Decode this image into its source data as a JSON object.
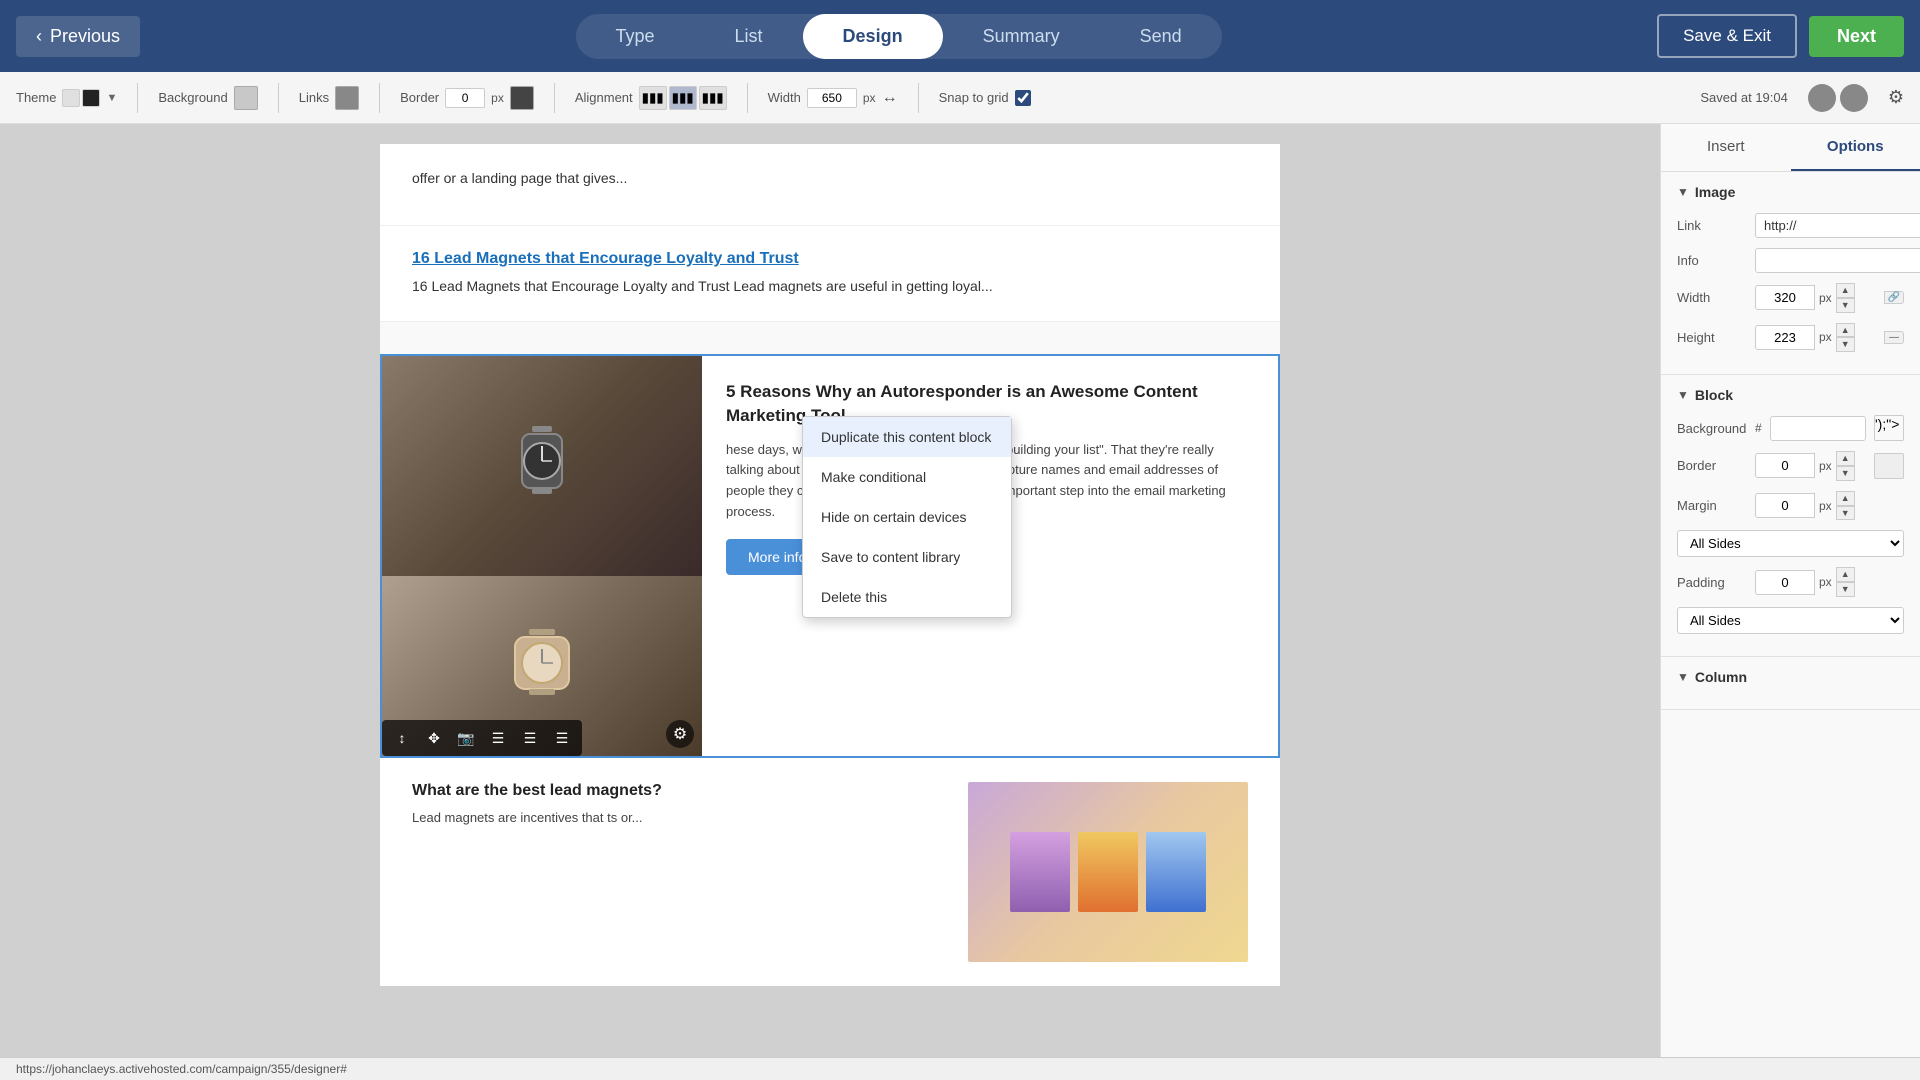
{
  "topNav": {
    "prevLabel": "Previous",
    "nextLabel": "Next",
    "saveExitLabel": "Save & Exit",
    "tabs": [
      {
        "id": "type",
        "label": "Type"
      },
      {
        "id": "list",
        "label": "List"
      },
      {
        "id": "design",
        "label": "Design",
        "active": true
      },
      {
        "id": "summary",
        "label": "Summary"
      },
      {
        "id": "send",
        "label": "Send"
      }
    ]
  },
  "toolbar": {
    "themeLabel": "Theme",
    "backgroundLabel": "Background",
    "linksLabel": "Links",
    "borderLabel": "Border",
    "borderValue": "0",
    "borderUnit": "px",
    "alignmentLabel": "Alignment",
    "widthLabel": "Width",
    "widthValue": "650",
    "widthUnit": "px",
    "snapLabel": "Snap to grid",
    "snapChecked": true,
    "savedText": "Saved at 19:04"
  },
  "emailContent": {
    "truncatedText": "offer or a landing page that gives...",
    "articleLink": "16 Lead Magnets that Encourage Loyalty and Trust",
    "articleDesc": "16 Lead Magnets that Encourage Loyalty and Trust Lead magnets are useful in getting loyal...",
    "twoColHeading": "5 Reasons Why an Autoresponder is an Awesome Content Marketing Tool",
    "twoColBody": "hese days, we hear a lot of people alking about \"building your list\". That they're really talking about here is using an autoresponder to apture names and email addresses of people they can market to. This is an extremely important step into the email marketing process.",
    "moreInfoLabel": "More info",
    "bottomHeading": "What are the best lead magnets?",
    "bottomText": "Lead magnets are incentives that ts or..."
  },
  "contextMenu": {
    "items": [
      {
        "id": "duplicate",
        "label": "Duplicate this content block"
      },
      {
        "id": "conditional",
        "label": "Make conditional"
      },
      {
        "id": "hide-devices",
        "label": "Hide on certain devices"
      },
      {
        "id": "save-library",
        "label": "Save to content library"
      },
      {
        "id": "delete",
        "label": "Delete this"
      }
    ]
  },
  "rightPanel": {
    "tabs": [
      {
        "id": "insert",
        "label": "Insert"
      },
      {
        "id": "options",
        "label": "Options",
        "active": true
      }
    ],
    "imageSection": {
      "title": "Image",
      "linkLabel": "Link",
      "linkValue": "http://",
      "infoLabel": "Info",
      "infoValue": "",
      "widthLabel": "Width",
      "widthValue": "320",
      "widthUnit": "px",
      "heightLabel": "Height",
      "heightValue": "223",
      "heightUnit": "px"
    },
    "blockSection": {
      "title": "Block",
      "backgroundLabel": "Background",
      "backgroundHash": "#",
      "borderLabel": "Border",
      "borderValue": "0",
      "borderUnit": "px",
      "marginLabel": "Margin",
      "marginValue": "0",
      "marginUnit": "px",
      "marginSides": "All Sides",
      "paddingLabel": "Padding",
      "paddingValue": "0",
      "paddingUnit": "px",
      "paddingSides": "All Sides"
    },
    "columnSection": {
      "title": "Column"
    }
  },
  "statusBar": {
    "url": "https://johanclaeys.activehosted.com/campaign/355/designer#"
  }
}
